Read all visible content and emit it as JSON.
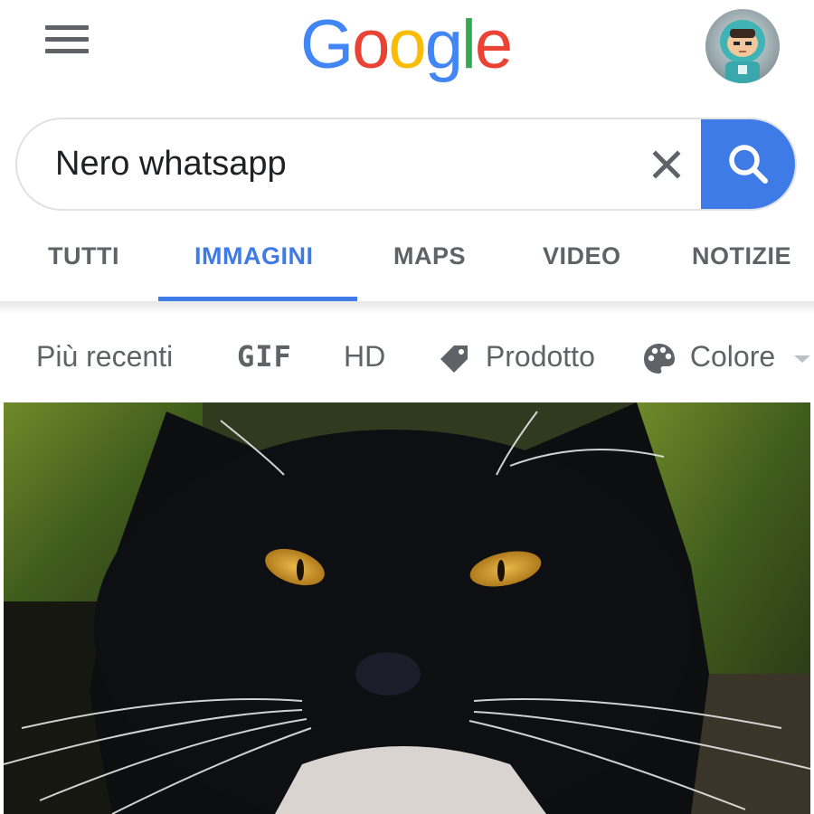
{
  "header": {
    "logo_letters": [
      {
        "ch": "G",
        "color": "#4285F4"
      },
      {
        "ch": "o",
        "color": "#EA4335"
      },
      {
        "ch": "o",
        "color": "#FBBC05"
      },
      {
        "ch": "g",
        "color": "#4285F4"
      },
      {
        "ch": "l",
        "color": "#34A853"
      },
      {
        "ch": "e",
        "color": "#EA4335"
      }
    ],
    "menu_icon": "hamburger-menu-icon",
    "avatar_icon": "user-avatar"
  },
  "search": {
    "query": "Nero whatsapp",
    "clear_icon": "close-icon",
    "search_icon": "search-icon"
  },
  "tabs": [
    {
      "label": "TUTTI",
      "active": false
    },
    {
      "label": "IMMAGINI",
      "active": true
    },
    {
      "label": "MAPS",
      "active": false
    },
    {
      "label": "VIDEO",
      "active": false
    },
    {
      "label": "NOTIZIE",
      "active": false
    }
  ],
  "filters": {
    "recent": "Più recenti",
    "gif": "GIF",
    "hd": "HD",
    "product": "Prodotto",
    "color": "Colore"
  },
  "colors": {
    "accent": "#3f7be6",
    "text_secondary": "#5f6368"
  }
}
